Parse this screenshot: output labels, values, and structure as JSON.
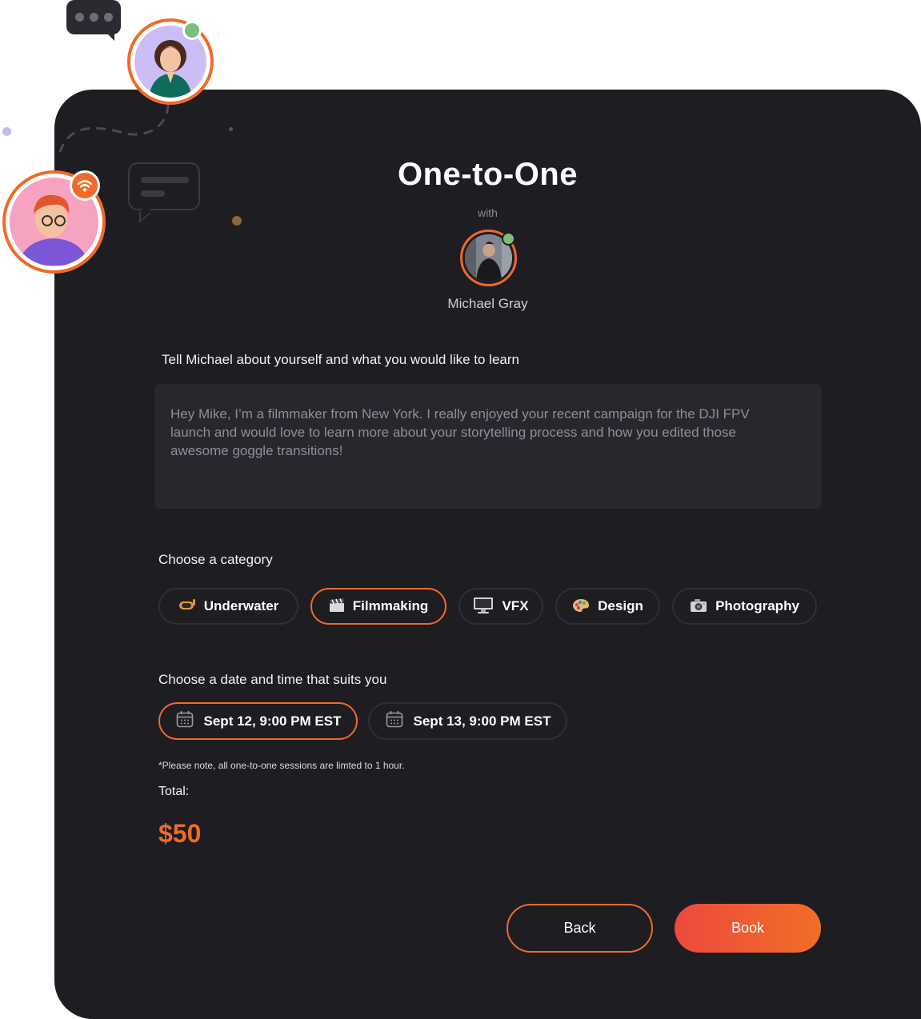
{
  "header": {
    "title": "One-to-One",
    "with_label": "with",
    "host_name": "Michael Gray"
  },
  "message": {
    "prompt": "Tell Michael about yourself and what you would like to learn",
    "text": "Hey Mike, I’m a filmmaker from New York. I really enjoyed your recent campaign for the DJI FPV launch and would love to learn more about your storytelling process and how you edited those awesome goggle transitions!"
  },
  "category": {
    "label": "Choose a category",
    "options": [
      {
        "label": "Underwater",
        "icon": "diving-mask-icon",
        "selected": false
      },
      {
        "label": "Filmmaking",
        "icon": "clapperboard-icon",
        "selected": true
      },
      {
        "label": "VFX",
        "icon": "monitor-icon",
        "selected": false
      },
      {
        "label": "Design",
        "icon": "palette-icon",
        "selected": false
      },
      {
        "label": "Photography",
        "icon": "camera-icon",
        "selected": false
      }
    ]
  },
  "schedule": {
    "label": "Choose a date and time that suits you",
    "options": [
      {
        "label": "Sept 12, 9:00 PM EST",
        "selected": true
      },
      {
        "label": "Sept 13, 9:00 PM EST",
        "selected": false
      }
    ],
    "note": "*Please note, all one-to-one sessions are limted to 1 hour."
  },
  "total": {
    "label": "Total:",
    "value": "$50"
  },
  "actions": {
    "back_label": "Back",
    "book_label": "Book"
  },
  "colors": {
    "accent": "#f06a2a",
    "card_background": "#1d1d22",
    "online_status": "#7cbf7a"
  }
}
